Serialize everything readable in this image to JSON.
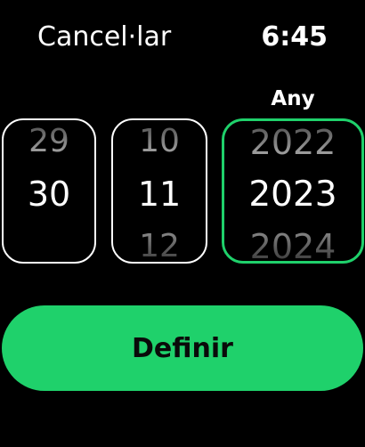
{
  "header": {
    "cancel_label": "Cancel·lar",
    "time": "6:45"
  },
  "pickers": {
    "day": {
      "prev": "29",
      "current": "30",
      "next": ""
    },
    "month": {
      "prev": "10",
      "current": "11",
      "next": "12"
    },
    "year": {
      "label": "Any",
      "prev": "2022",
      "current": "2023",
      "next": "2024"
    }
  },
  "actions": {
    "set_label": "Definir"
  },
  "colors": {
    "accent": "#1fd16b",
    "background": "#000000",
    "picker_border": "#ffffff"
  }
}
